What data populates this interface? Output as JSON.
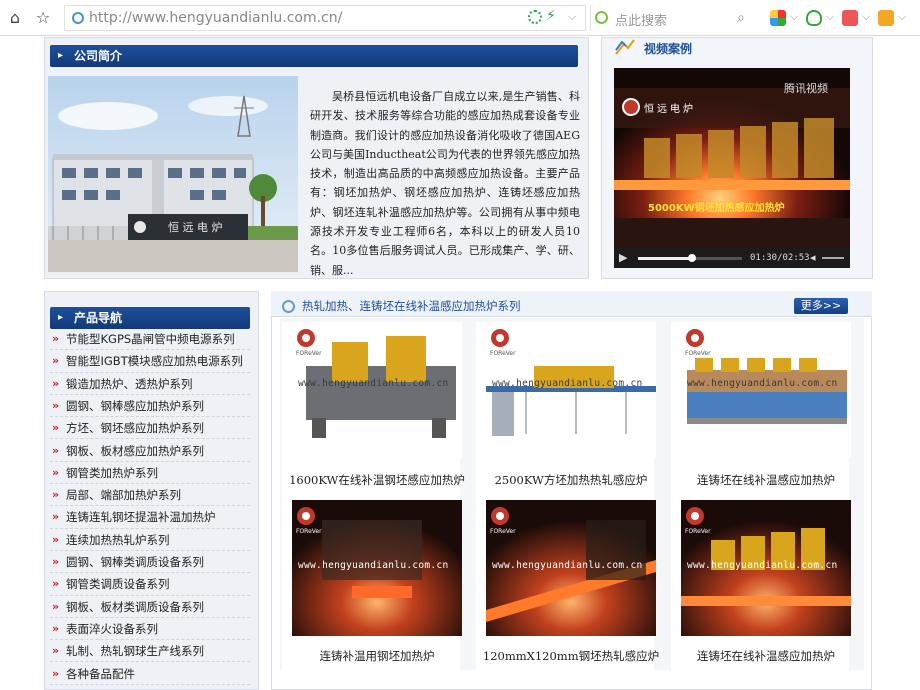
{
  "browser": {
    "url": "http://www.hengyuandianlu.com.cn/",
    "search_placeholder": "点此搜索"
  },
  "intro": {
    "title": "公司简介",
    "text": "吴桥县恒远机电设备厂自成立以来,是生产销售、科研开发、技术服务等综合功能的感应加热成套设备专业制造商。我们设计的感应加热设备消化吸收了德国AEG公司与美国Inductheat公司为代表的世界领先感应加热技术，制造出高品质的中高频感应加热设备。主要产品有：钢坯加热炉、钢坯感应加热炉、连铸坯感应加热炉、钢坯连轧补温感应加热炉等。公司拥有从事中频电源技术开发专业工程师6名，本科以上的研发人员10名。10多位售后服务调试人员。已形成集产、学、研、销、服..."
  },
  "video": {
    "title": "视频案例",
    "brand": "腾讯视频",
    "logo_text": "恒远电炉",
    "caption": "5000KW钢坯加热感应加热炉",
    "time": "01:30/02:53",
    "progress": 0.52
  },
  "nav": {
    "title": "产品导航",
    "items": [
      "节能型KGPS晶闸管中频电源系列",
      "智能型IGBT模块感应加热电源系列",
      "锻造加热炉、透热炉系列",
      "圆钢、钢棒感应加热炉系列",
      "方坯、钢坯感应加热炉系列",
      "钢板、板材感应加热炉系列",
      "钢管类加热炉系列",
      "局部、端部加热炉系列",
      "连铸连轧钢坯提温补温加热炉",
      "连续加热热轧炉系列",
      "圆钢、钢棒类调质设备系列",
      "钢管类调质设备系列",
      "钢板、板材类调质设备系列",
      "表面淬火设备系列",
      "轧制、热轧钢球生产线系列",
      "各种备品配件"
    ]
  },
  "products": {
    "title": "热轧加热、连铸坯在线补温感应加热炉系列",
    "more": "更多>>",
    "brand": "FOReVer",
    "watermark": "www.hengyuandianlu.com.cn",
    "items": [
      {
        "caption": "1600KW在线补温钢坯感应加热炉"
      },
      {
        "caption": "2500KW方坯加热热轧感应炉"
      },
      {
        "caption": "连铸坯在线补温感应加热炉"
      },
      {
        "caption": "连铸补温用钢坯加热炉"
      },
      {
        "caption": "120mmX120mm钢坯热轧感应炉"
      },
      {
        "caption": "连铸坯在线补温感应加热炉"
      }
    ]
  }
}
